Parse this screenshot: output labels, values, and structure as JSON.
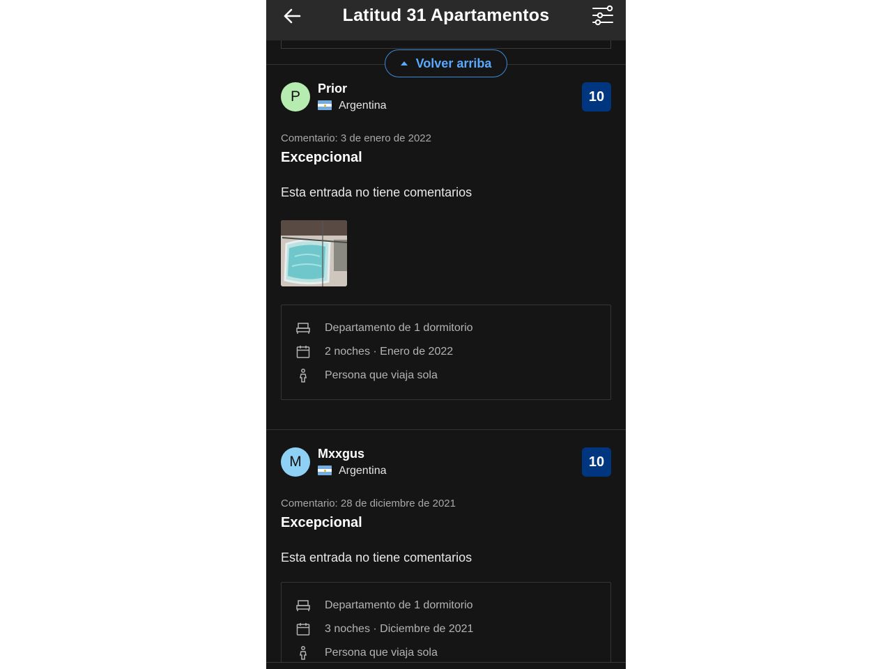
{
  "app_bar": {
    "title": "Latitud 31 Apartamentos",
    "back_icon": "arrow-left-icon",
    "filter_icon": "sliders-icon"
  },
  "back_to_top": {
    "label": "Volver arriba"
  },
  "colors": {
    "background": "#151515",
    "app_bar": "#2a2a2a",
    "accent_link": "#5aa9ff",
    "score_badge": "#003580"
  },
  "reviews": [
    {
      "avatar_letter": "P",
      "avatar_color": "#b7ecb1",
      "name": "Prior",
      "country": "Argentina",
      "score": "10",
      "date": "Comentario: 3 de enero de 2022",
      "title": "Excepcional",
      "text": "Esta entrada no tiene comentarios",
      "has_photo": true,
      "stay": {
        "room": "Departamento de 1 dormitorio",
        "nights": "2 noches · Enero de 2022",
        "traveler": "Persona que viaja sola"
      }
    },
    {
      "avatar_letter": "M",
      "avatar_color": "#8fd0f5",
      "name": "Mxxgus",
      "country": "Argentina",
      "score": "10",
      "date": "Comentario: 28 de diciembre de 2021",
      "title": "Excepcional",
      "text": "Esta entrada no tiene comentarios",
      "has_photo": false,
      "stay": {
        "room": "Departamento de 1 dormitorio",
        "nights": "3 noches · Diciembre de 2021",
        "traveler": "Persona que viaja sola"
      }
    }
  ]
}
